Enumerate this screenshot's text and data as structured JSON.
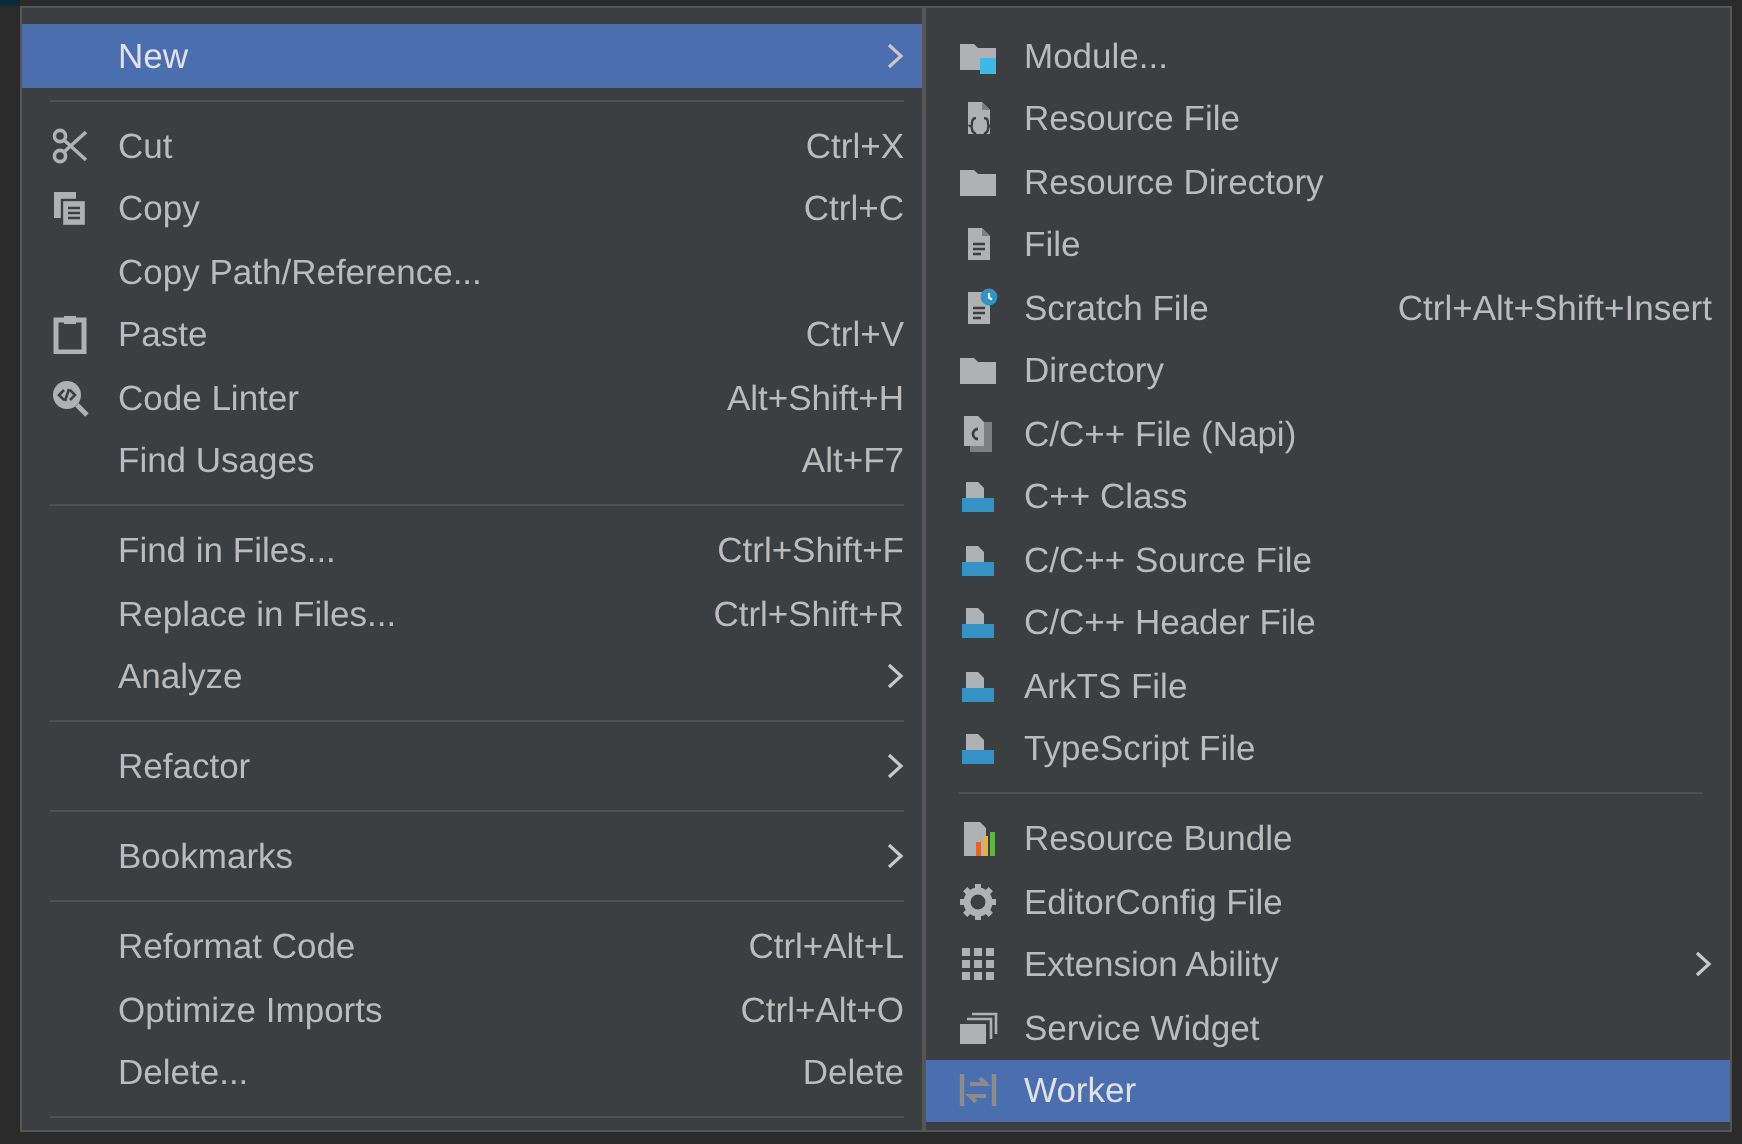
{
  "context_menu": {
    "items": [
      {
        "kind": "item",
        "label": "New",
        "has_submenu": true,
        "selected": true
      },
      {
        "kind": "separator"
      },
      {
        "kind": "item",
        "label": "Cut",
        "shortcut": "Ctrl+X",
        "has_submenu": false,
        "selected": false
      },
      {
        "kind": "item",
        "label": "Copy",
        "shortcut": "Ctrl+C",
        "has_submenu": false,
        "selected": false
      },
      {
        "kind": "item",
        "label": "Copy Path/Reference...",
        "has_submenu": false,
        "selected": false
      },
      {
        "kind": "item",
        "label": "Paste",
        "shortcut": "Ctrl+V",
        "has_submenu": false,
        "selected": false
      },
      {
        "kind": "item",
        "label": "Code Linter",
        "shortcut": "Alt+Shift+H",
        "has_submenu": false,
        "selected": false
      },
      {
        "kind": "item",
        "label": "Find Usages",
        "shortcut": "Alt+F7",
        "has_submenu": false,
        "selected": false
      },
      {
        "kind": "separator"
      },
      {
        "kind": "item",
        "label": "Find in Files...",
        "shortcut": "Ctrl+Shift+F",
        "has_submenu": false,
        "selected": false
      },
      {
        "kind": "item",
        "label": "Replace in Files...",
        "shortcut": "Ctrl+Shift+R",
        "has_submenu": false,
        "selected": false
      },
      {
        "kind": "item",
        "label": "Analyze",
        "has_submenu": true,
        "selected": false
      },
      {
        "kind": "separator"
      },
      {
        "kind": "item",
        "label": "Refactor",
        "has_submenu": true,
        "selected": false
      },
      {
        "kind": "separator"
      },
      {
        "kind": "item",
        "label": "Bookmarks",
        "has_submenu": true,
        "selected": false
      },
      {
        "kind": "separator"
      },
      {
        "kind": "item",
        "label": "Reformat Code",
        "shortcut": "Ctrl+Alt+L",
        "has_submenu": false,
        "selected": false
      },
      {
        "kind": "item",
        "label": "Optimize Imports",
        "shortcut": "Ctrl+Alt+O",
        "has_submenu": false,
        "selected": false
      },
      {
        "kind": "item",
        "label": "Delete...",
        "shortcut": "Delete",
        "has_submenu": false,
        "selected": false
      },
      {
        "kind": "separator"
      }
    ]
  },
  "new_submenu": {
    "items": [
      {
        "kind": "item",
        "label": "Module...",
        "has_submenu": false,
        "selected": false
      },
      {
        "kind": "item",
        "label": "Resource File",
        "has_submenu": false,
        "selected": false
      },
      {
        "kind": "item",
        "label": "Resource Directory",
        "has_submenu": false,
        "selected": false
      },
      {
        "kind": "item",
        "label": "File",
        "has_submenu": false,
        "selected": false
      },
      {
        "kind": "item",
        "label": "Scratch File",
        "shortcut": "Ctrl+Alt+Shift+Insert",
        "has_submenu": false,
        "selected": false
      },
      {
        "kind": "item",
        "label": "Directory",
        "has_submenu": false,
        "selected": false
      },
      {
        "kind": "item",
        "label": "C/C++ File (Napi)",
        "has_submenu": false,
        "selected": false
      },
      {
        "kind": "item",
        "label": "C++ Class",
        "has_submenu": false,
        "selected": false
      },
      {
        "kind": "item",
        "label": "C/C++ Source File",
        "has_submenu": false,
        "selected": false
      },
      {
        "kind": "item",
        "label": "C/C++ Header File",
        "has_submenu": false,
        "selected": false
      },
      {
        "kind": "item",
        "label": "ArkTS File",
        "has_submenu": false,
        "selected": false
      },
      {
        "kind": "item",
        "label": "TypeScript File",
        "has_submenu": false,
        "selected": false
      },
      {
        "kind": "separator"
      },
      {
        "kind": "item",
        "label": "Resource Bundle",
        "has_submenu": false,
        "selected": false
      },
      {
        "kind": "item",
        "label": "EditorConfig File",
        "has_submenu": false,
        "selected": false
      },
      {
        "kind": "item",
        "label": "Extension Ability",
        "has_submenu": true,
        "selected": false
      },
      {
        "kind": "item",
        "label": "Service Widget",
        "has_submenu": false,
        "selected": false
      },
      {
        "kind": "item",
        "label": "Worker",
        "has_submenu": false,
        "selected": true
      }
    ]
  }
}
